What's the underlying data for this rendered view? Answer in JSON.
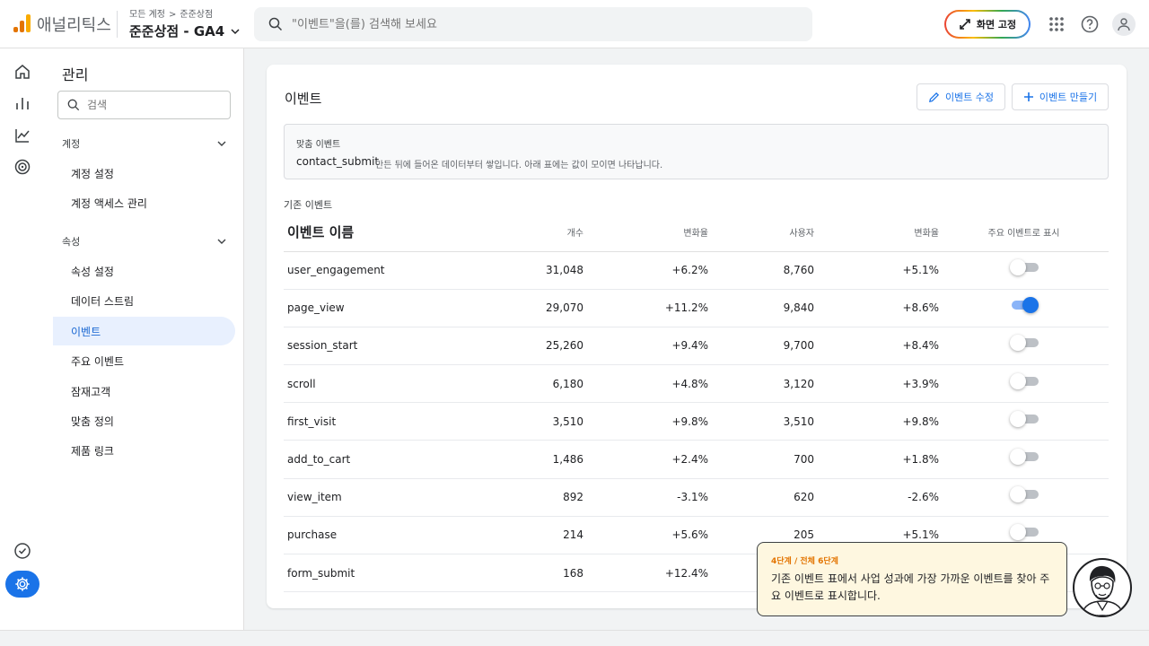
{
  "header": {
    "app_name": "애널리틱스",
    "breadcrumb": [
      "모든 계정",
      "준준상점"
    ],
    "breadcrumb_sep": ">",
    "property": "준준상점 - GA4",
    "search_placeholder": "\"이벤트\"을(를) 검색해 보세요",
    "pin_label": "화면 고정",
    "logo_colors": [
      "#f9ab00",
      "#e37400",
      "#e37400"
    ]
  },
  "sidebar": {
    "title": "관리",
    "search_placeholder": "검색",
    "sections": [
      {
        "label": "계정",
        "items": [
          "계정 설정",
          "계정 액세스 관리"
        ]
      },
      {
        "label": "속성",
        "items": [
          "속성 설정",
          "데이터 스트림",
          "이벤트",
          "주요 이벤트",
          "잠재고객",
          "맞춤 정의",
          "제품 링크"
        ]
      }
    ],
    "active_item": "이벤트"
  },
  "main": {
    "title": "이벤트",
    "edit_button": "이벤트 수정",
    "create_button": "이벤트 만들기",
    "custom": {
      "label": "맞춤 이벤트",
      "event": "contact_submit",
      "note": "만든 뒤에 들어온 데이터부터 쌓입니다. 아래 표에는 값이 모이면 나타납니다."
    },
    "base_label": "기존 이벤트",
    "columns": [
      "이벤트 이름",
      "개수",
      "변화율",
      "사용자",
      "변화율",
      "주요 이벤트로 표시"
    ],
    "rows": [
      {
        "name": "user_engagement",
        "count": "31,048",
        "count_change": "+6.2%",
        "users": "8,760",
        "users_change": "+5.1%",
        "key": false
      },
      {
        "name": "page_view",
        "count": "29,070",
        "count_change": "+11.2%",
        "users": "9,840",
        "users_change": "+8.6%",
        "key": true
      },
      {
        "name": "session_start",
        "count": "25,260",
        "count_change": "+9.4%",
        "users": "9,700",
        "users_change": "+8.4%",
        "key": false
      },
      {
        "name": "scroll",
        "count": "6,180",
        "count_change": "+4.8%",
        "users": "3,120",
        "users_change": "+3.9%",
        "key": false
      },
      {
        "name": "first_visit",
        "count": "3,510",
        "count_change": "+9.8%",
        "users": "3,510",
        "users_change": "+9.8%",
        "key": false
      },
      {
        "name": "add_to_cart",
        "count": "1,486",
        "count_change": "+2.4%",
        "users": "700",
        "users_change": "+1.8%",
        "key": false
      },
      {
        "name": "view_item",
        "count": "892",
        "count_change": "-3.1%",
        "users": "620",
        "users_change": "-2.6%",
        "key": false
      },
      {
        "name": "purchase",
        "count": "214",
        "count_change": "+5.6%",
        "users": "205",
        "users_change": "+5.1%",
        "key": false
      },
      {
        "name": "form_submit",
        "count": "168",
        "count_change": "+12.4%",
        "users": "",
        "users_change": "",
        "key": false
      }
    ]
  },
  "tooltip": {
    "step": "4단계 / 전체 6단계",
    "message": "기존 이벤트 표에서 사업 성과에 가장 가까운 이벤트를 찾아 주요 이벤트로 표시합니다."
  },
  "colors": {
    "accent": "#1a73e8",
    "active_bg": "#e8f0fe",
    "negative": "#d93025",
    "tooltip_bg": "#fef7e0",
    "step_color": "#e37400"
  }
}
